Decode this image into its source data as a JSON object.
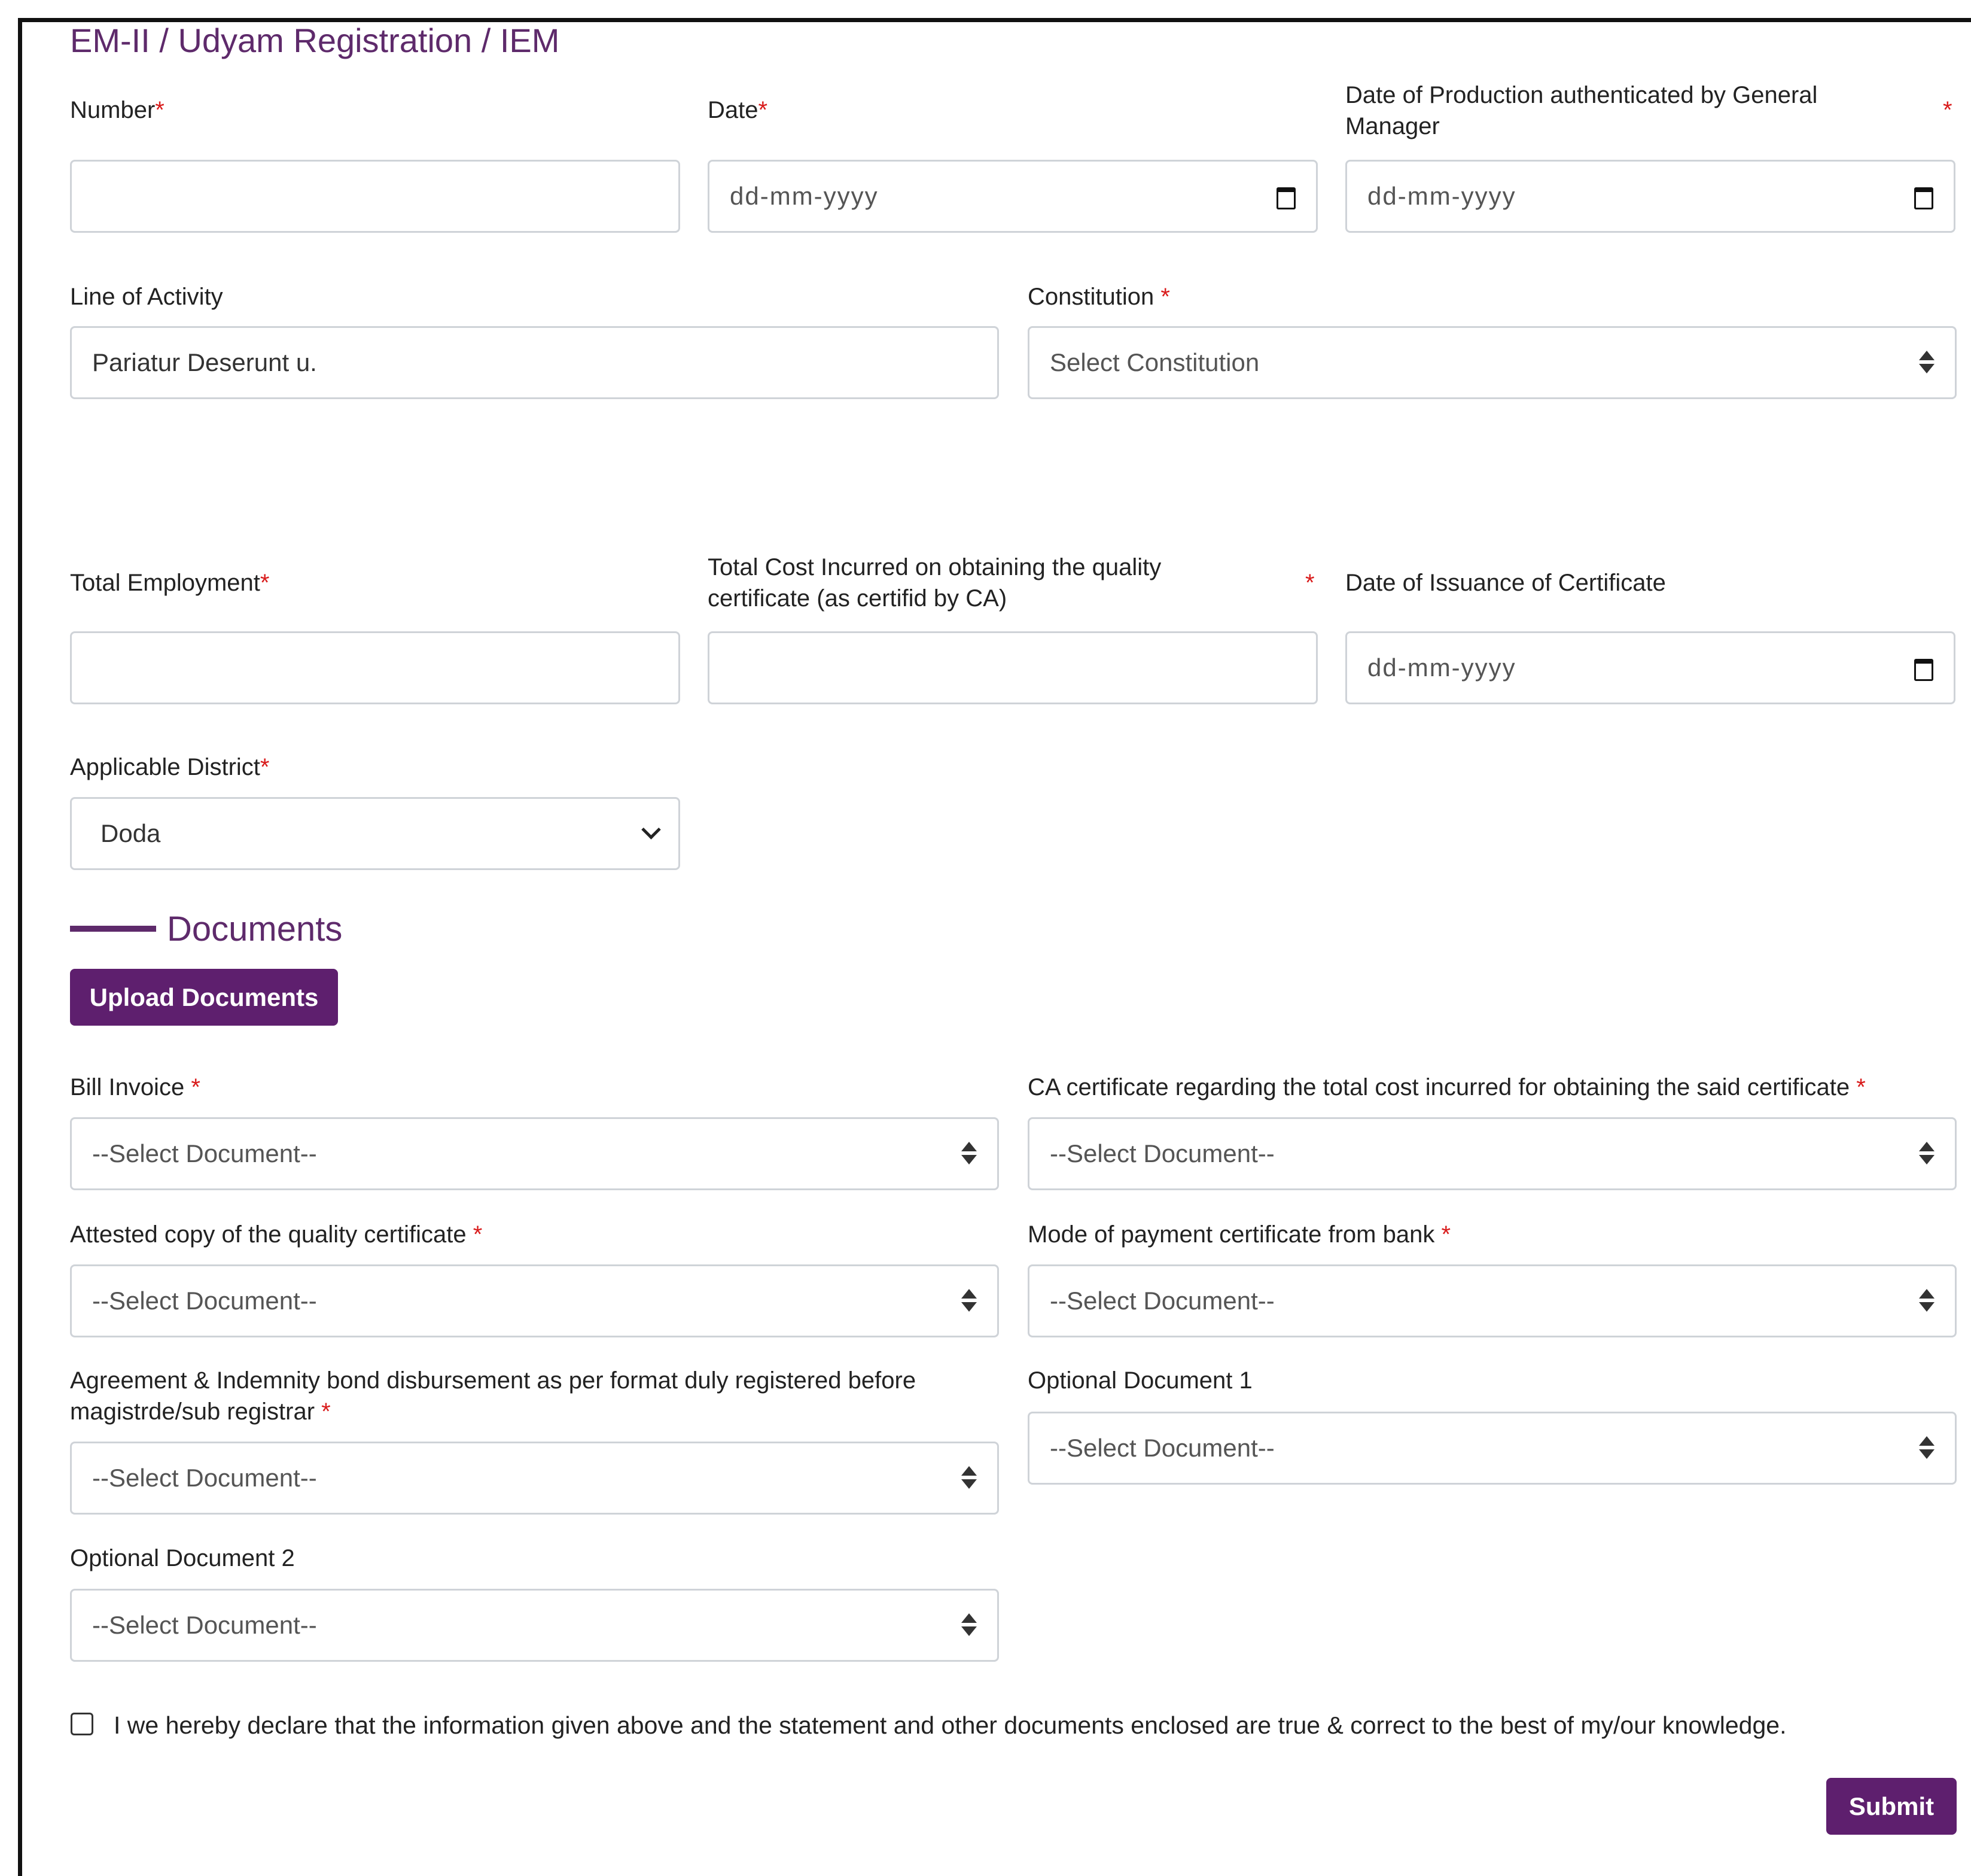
{
  "form": {
    "section_title": "EM-II / Udyam Registration / IEM",
    "required_mark": "*",
    "fields": {
      "number": {
        "label": "Number",
        "value": ""
      },
      "date": {
        "label": "Date",
        "placeholder": "dd-mm-yyyy"
      },
      "date_production": {
        "label": "Date of Production authenticated by General Manager",
        "placeholder": "dd-mm-yyyy"
      },
      "line_of_activity": {
        "label": "Line of Activity",
        "value": "Pariatur Deserunt u."
      },
      "constitution": {
        "label": "Constitution",
        "selected": "Select Constitution"
      },
      "total_employment": {
        "label": "Total Employment",
        "value": ""
      },
      "total_cost": {
        "label": "Total Cost Incurred on obtaining the quality certificate (as certifid by CA)",
        "value": ""
      },
      "date_issuance": {
        "label": "Date of Issuance of Certificate",
        "placeholder": "dd-mm-yyyy"
      },
      "applicable_district": {
        "label": "Applicable District",
        "selected": "Doda"
      }
    }
  },
  "documents": {
    "title": "Documents",
    "upload_button": "Upload Documents",
    "select_placeholder": "--Select Document--",
    "items": {
      "bill_invoice": "Bill Invoice",
      "ca_certificate": "CA certificate regarding the total cost incurred for obtaining the said certificate",
      "attested_copy": "Attested copy of the quality certificate",
      "mode_of_payment": "Mode of payment certificate from bank",
      "agreement_bond": "Agreement & Indemnity bond disbursement as per format duly registered before magistrde/sub registrar",
      "optional_1": "Optional Document 1",
      "optional_2": "Optional Document 2"
    }
  },
  "declaration": {
    "checked": false,
    "text": "I we hereby declare that the information given above and the statement and other documents enclosed are true & correct to the best of my/our knowledge."
  },
  "submit_label": "Submit",
  "colors": {
    "brand": "#5e1f6e",
    "required": "#d91c1c",
    "border": "#cfd3d8"
  },
  "icons": {
    "date_picker": "calendar-icon",
    "select": "sort-updown-icon",
    "dropdown": "chevron-down-icon"
  }
}
